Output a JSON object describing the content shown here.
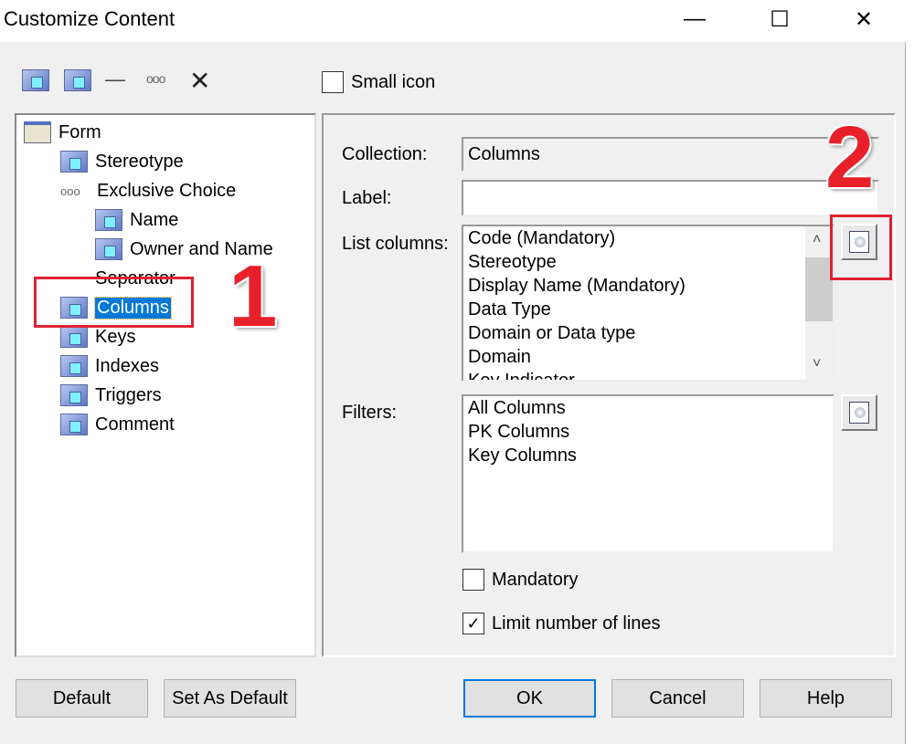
{
  "window": {
    "title": "Customize Content",
    "minimize": "—",
    "maximize": "☐",
    "close": "✕"
  },
  "toolbar": {
    "items": [
      {
        "icon": "add-item-icon"
      },
      {
        "icon": "add-group-icon"
      },
      {
        "icon": "separator-icon",
        "glyph": "—"
      },
      {
        "icon": "exclusive-choice-icon",
        "glyph": "ooo"
      },
      {
        "icon": "delete-icon",
        "glyph": "✕"
      }
    ],
    "small_icon_label": "Small icon",
    "small_icon_checked": false
  },
  "tree": {
    "items": [
      {
        "label": "Form",
        "level": 0,
        "icon": "form-icon"
      },
      {
        "label": "Stereotype",
        "level": 1,
        "icon": "attribute-icon"
      },
      {
        "label": "Exclusive Choice",
        "level": 1,
        "icon": "exclusive-choice-icon"
      },
      {
        "label": "Name",
        "level": 2,
        "icon": "attribute-icon"
      },
      {
        "label": "Owner and Name",
        "level": 2,
        "icon": "attribute-icon"
      },
      {
        "label": "Separator",
        "level": 1,
        "icon": "separator-icon"
      },
      {
        "label": "Columns",
        "level": 1,
        "icon": "attribute-icon",
        "selected": true
      },
      {
        "label": "Keys",
        "level": 1,
        "icon": "attribute-icon"
      },
      {
        "label": "Indexes",
        "level": 1,
        "icon": "attribute-icon"
      },
      {
        "label": "Triggers",
        "level": 1,
        "icon": "attribute-icon"
      },
      {
        "label": "Comment",
        "level": 1,
        "icon": "attribute-icon"
      }
    ]
  },
  "form": {
    "collection_label": "Collection:",
    "collection_value": "Columns",
    "label_label": "Label:",
    "label_value": "",
    "list_columns_label": "List columns:",
    "list_columns": [
      "Code (Mandatory)",
      "Stereotype",
      "Display Name (Mandatory)",
      "Data Type",
      "Domain or Data type",
      "Domain",
      "Key Indicator"
    ],
    "filters_label": "Filters:",
    "filters": [
      "All Columns",
      "PK Columns",
      "Key Columns"
    ],
    "mandatory_label": "Mandatory",
    "mandatory_checked": false,
    "limit_label": "Limit number of lines",
    "limit_checked": true
  },
  "annotations": {
    "one": "1",
    "two": "2",
    "color": "#e02030"
  },
  "buttons": {
    "default": "Default",
    "set_as_default": "Set As Default",
    "ok": "OK",
    "cancel": "Cancel",
    "help": "Help"
  }
}
